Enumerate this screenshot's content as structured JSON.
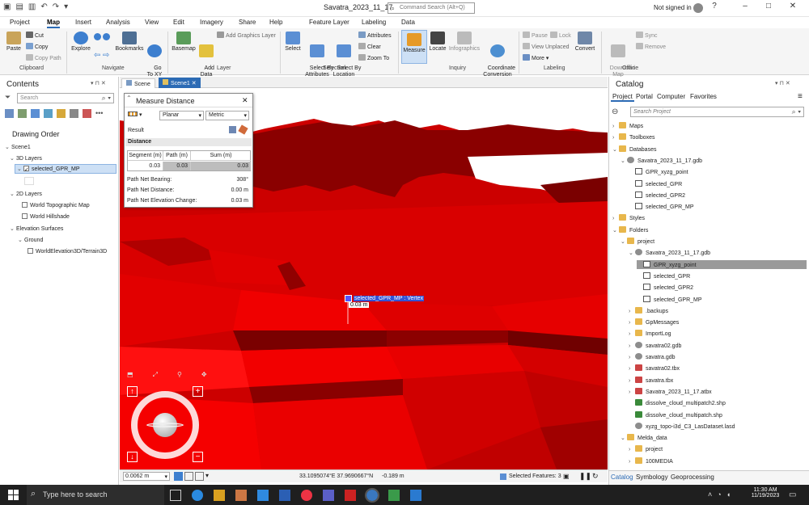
{
  "window": {
    "title": "Savatra_2023_11_17",
    "command_search_placeholder": "Command Search (Alt+Q)",
    "signed_in": "Not signed in"
  },
  "menu": {
    "tabs": [
      "Project",
      "Map",
      "Insert",
      "Analysis",
      "View",
      "Edit",
      "Imagery",
      "Share",
      "Help",
      "Feature Layer",
      "Labeling",
      "Data"
    ],
    "active": "Map"
  },
  "ribbon": {
    "paste": "Paste",
    "cut": "Cut",
    "copy": "Copy",
    "copy_path": "Copy Path",
    "explore": "Explore",
    "bookmarks": "Bookmarks",
    "goto": "Go\nTo XY",
    "basemap": "Basemap",
    "add_data": "Add\nData",
    "add_graphics": "Add Graphics Layer",
    "select": "Select",
    "select_attr": "Select By\nAttributes",
    "select_loc": "Select By\nLocation",
    "attributes": "Attributes",
    "clear": "Clear",
    "zoom_to": "Zoom To",
    "measure": "Measure",
    "locate": "Locate",
    "infographics": "Infographics",
    "coord_conv": "Coordinate\nConversion",
    "pause": "Pause",
    "lock": "Lock",
    "view_unplaced": "View Unplaced",
    "more": "More",
    "convert": "Convert",
    "download_map": "Download\nMap",
    "sync": "Sync",
    "remove": "Remove",
    "groups": [
      "Clipboard",
      "Navigate",
      "Layer",
      "Selection",
      "Inquiry",
      "Labeling",
      "Offline"
    ]
  },
  "contents": {
    "title": "Contents",
    "search_placeholder": "Search",
    "drawing_order": "Drawing Order",
    "scene": "Scene1",
    "layers_3d": "3D Layers",
    "selected_layer": "selected_GPR_MP",
    "layers_2d": "2D Layers",
    "topo": "World Topographic Map",
    "hillshade": "World Hillshade",
    "elev": "Elevation Surfaces",
    "ground": "Ground",
    "terrain": "WorldElevation3D/Terrain3D"
  },
  "view_tabs": [
    "Scene",
    "Scene1"
  ],
  "measure": {
    "title": "Measure Distance",
    "mode": "Planar",
    "unit": "Metric",
    "result": "Result",
    "distance": "Distance",
    "cols": [
      "Segment (m)",
      "Path (m)",
      "Sum (m)"
    ],
    "vals": [
      "0.03",
      "0.03",
      "0.03"
    ],
    "bearing_label": "Path Net Bearing:",
    "bearing": "308°",
    "netdist_label": "Path Net Distance:",
    "netdist": "0.00 m",
    "elev_label": "Path Net Elevation Change:",
    "elev": "0.03 m"
  },
  "scene_label": {
    "snap": "selected_GPR_MP : Vertex",
    "dist": "0.03 m"
  },
  "statusbar": {
    "scale": "0.0062 m",
    "coords": "33.1095074°E 37.9690667°N",
    "elev": "-0.189 m",
    "selected": "Selected Features: 3"
  },
  "catalog": {
    "title": "Catalog",
    "tabs": [
      "Project",
      "Portal",
      "Computer",
      "Favorites"
    ],
    "search_placeholder": "Search Project",
    "items": [
      {
        "label": "Maps",
        "icon": "folder",
        "indent": 0,
        "arrow": "›"
      },
      {
        "label": "Toolboxes",
        "icon": "folder",
        "indent": 0,
        "arrow": "›"
      },
      {
        "label": "Databases",
        "icon": "folder",
        "indent": 0,
        "arrow": "⌄"
      },
      {
        "label": "Savatra_2023_11_17.gdb",
        "icon": "gdb",
        "indent": 1,
        "arrow": "⌄"
      },
      {
        "label": "GPR_xyzg_point",
        "icon": "fc",
        "indent": 2,
        "arrow": ""
      },
      {
        "label": "selected_GPR",
        "icon": "fc",
        "indent": 2,
        "arrow": ""
      },
      {
        "label": "selected_GPR2",
        "icon": "fc",
        "indent": 2,
        "arrow": ""
      },
      {
        "label": "selected_GPR_MP",
        "icon": "fc",
        "indent": 2,
        "arrow": ""
      },
      {
        "label": "Styles",
        "icon": "folder",
        "indent": 0,
        "arrow": "›"
      },
      {
        "label": "Folders",
        "icon": "folder",
        "indent": 0,
        "arrow": "⌄"
      },
      {
        "label": "project",
        "icon": "folder",
        "indent": 1,
        "arrow": "⌄"
      },
      {
        "label": "Savatra_2023_11_17.gdb",
        "icon": "gdb",
        "indent": 2,
        "arrow": "⌄"
      },
      {
        "label": "GPR_xyzg_point",
        "icon": "fc",
        "indent": 3,
        "arrow": "",
        "selected": true
      },
      {
        "label": "selected_GPR",
        "icon": "fc",
        "indent": 3,
        "arrow": ""
      },
      {
        "label": "selected_GPR2",
        "icon": "fc",
        "indent": 3,
        "arrow": ""
      },
      {
        "label": "selected_GPR_MP",
        "icon": "fc",
        "indent": 3,
        "arrow": ""
      },
      {
        "label": ".backups",
        "icon": "folder",
        "indent": 2,
        "arrow": "›"
      },
      {
        "label": "GpMessages",
        "icon": "folder",
        "indent": 2,
        "arrow": "›"
      },
      {
        "label": "ImportLog",
        "icon": "folder",
        "indent": 2,
        "arrow": "›"
      },
      {
        "label": "savatra02.gdb",
        "icon": "gdb",
        "indent": 2,
        "arrow": "›"
      },
      {
        "label": "savatra.gdb",
        "icon": "gdb",
        "indent": 2,
        "arrow": "›"
      },
      {
        "label": "savatra02.tbx",
        "icon": "tbx",
        "indent": 2,
        "arrow": "›"
      },
      {
        "label": "savatra.tbx",
        "icon": "tbx",
        "indent": 2,
        "arrow": "›"
      },
      {
        "label": "Savatra_2023_11_17.atbx",
        "icon": "tbx",
        "indent": 2,
        "arrow": "›"
      },
      {
        "label": "dissolve_cloud_multipatch2.shp",
        "icon": "shp",
        "indent": 2,
        "arrow": ""
      },
      {
        "label": "dissolve_cloud_multipatch.shp",
        "icon": "shp",
        "indent": 2,
        "arrow": ""
      },
      {
        "label": "xyzg_topo-i3d_C3_LasDataset.lasd",
        "icon": "gdb",
        "indent": 2,
        "arrow": ""
      },
      {
        "label": "Melda_data",
        "icon": "folder",
        "indent": 1,
        "arrow": "⌄"
      },
      {
        "label": "project",
        "icon": "folder",
        "indent": 2,
        "arrow": "›"
      },
      {
        "label": "100MEDIA",
        "icon": "folder",
        "indent": 2,
        "arrow": "›"
      }
    ],
    "bottom_tabs": [
      "Catalog",
      "Symbology",
      "Geoprocessing"
    ]
  },
  "taskbar": {
    "search_placeholder": "Type here to search",
    "time": "11:30 AM",
    "date": "11/19/2023"
  },
  "colors": {
    "accent": "#2c6bb5",
    "scene_red": "#cc0000",
    "taskbar": "#1f1f1f"
  }
}
